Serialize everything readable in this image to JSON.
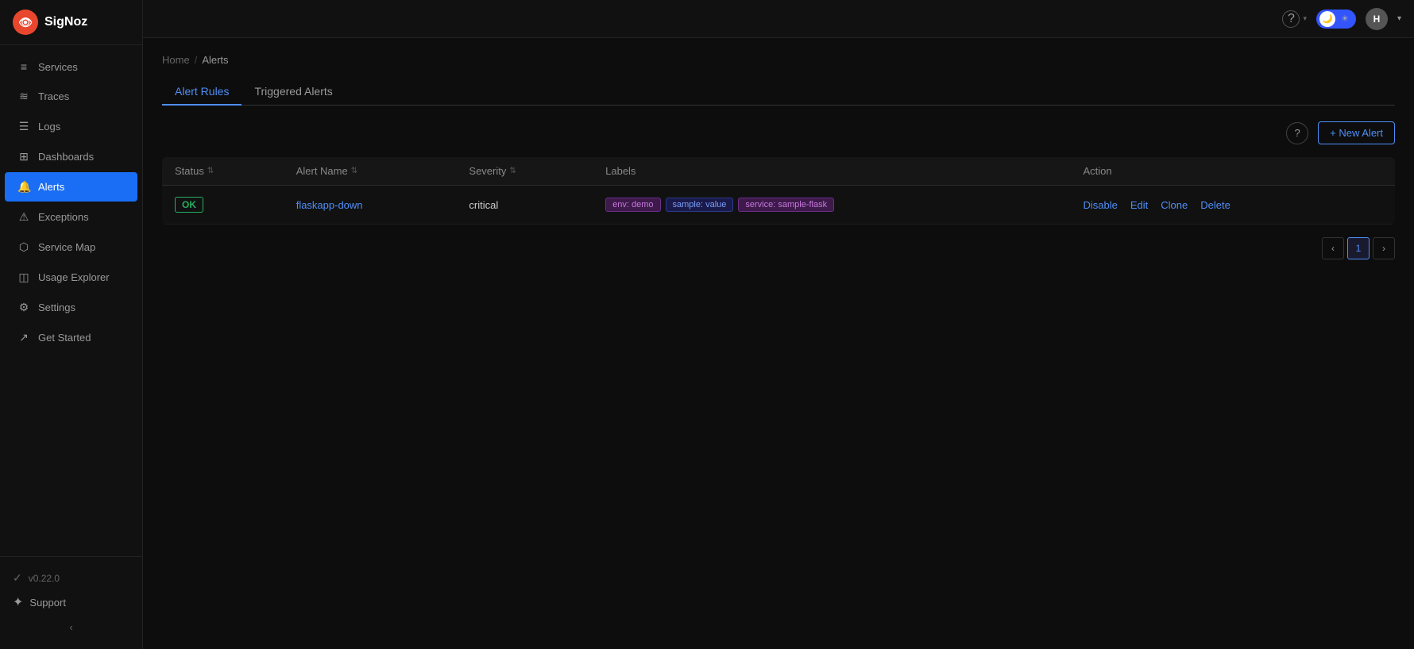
{
  "app": {
    "name": "SigNoz",
    "logo_letter": "👁"
  },
  "topbar": {
    "help_label": "?",
    "avatar_letter": "H",
    "theme": "dark"
  },
  "sidebar": {
    "items": [
      {
        "id": "services",
        "label": "Services",
        "icon": "≡",
        "active": false
      },
      {
        "id": "traces",
        "label": "Traces",
        "icon": "≋",
        "active": false
      },
      {
        "id": "logs",
        "label": "Logs",
        "icon": "≡",
        "active": false
      },
      {
        "id": "dashboards",
        "label": "Dashboards",
        "icon": "⊞",
        "active": false
      },
      {
        "id": "alerts",
        "label": "Alerts",
        "icon": "🔔",
        "active": true
      },
      {
        "id": "exceptions",
        "label": "Exceptions",
        "icon": "⚠",
        "active": false
      },
      {
        "id": "service-map",
        "label": "Service Map",
        "icon": "⬡",
        "active": false
      },
      {
        "id": "usage-explorer",
        "label": "Usage Explorer",
        "icon": "◫",
        "active": false
      },
      {
        "id": "settings",
        "label": "Settings",
        "icon": "⚙",
        "active": false
      },
      {
        "id": "get-started",
        "label": "Get Started",
        "icon": "↗",
        "active": false
      }
    ],
    "version": "v0.22.0",
    "support_label": "Support",
    "collapse_icon": "‹"
  },
  "breadcrumb": {
    "home": "Home",
    "separator": "/",
    "current": "Alerts"
  },
  "tabs": [
    {
      "id": "alert-rules",
      "label": "Alert Rules",
      "active": true
    },
    {
      "id": "triggered-alerts",
      "label": "Triggered Alerts",
      "active": false
    }
  ],
  "toolbar": {
    "new_alert_label": "+ New Alert"
  },
  "table": {
    "columns": [
      {
        "id": "status",
        "label": "Status"
      },
      {
        "id": "alert-name",
        "label": "Alert Name"
      },
      {
        "id": "severity",
        "label": "Severity"
      },
      {
        "id": "labels",
        "label": "Labels"
      },
      {
        "id": "action",
        "label": "Action"
      }
    ],
    "rows": [
      {
        "status": "OK",
        "alert_name": "flaskapp-down",
        "severity": "critical",
        "labels": [
          {
            "text": "env: demo",
            "type": "env"
          },
          {
            "text": "sample: value",
            "type": "sample"
          },
          {
            "text": "service: sample-flask",
            "type": "service"
          }
        ],
        "actions": [
          "Disable",
          "Edit",
          "Clone",
          "Delete"
        ]
      }
    ]
  },
  "pagination": {
    "prev_label": "‹",
    "next_label": "›",
    "current_page": 1,
    "pages": [
      1
    ]
  }
}
